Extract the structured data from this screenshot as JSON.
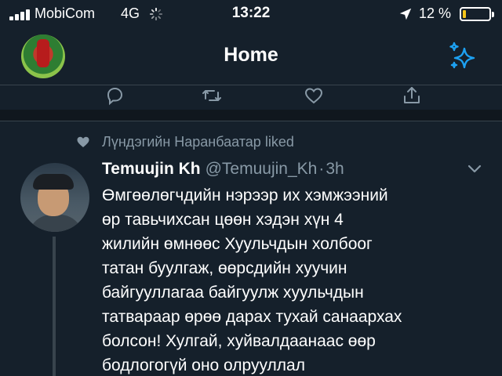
{
  "status_bar": {
    "carrier": "MobiCom",
    "network": "4G",
    "time": "13:22",
    "battery_text": "12 %",
    "battery_level": 0.12,
    "signal_bars": 4
  },
  "header": {
    "title": "Home",
    "accent_color": "#1da1f2"
  },
  "prev_tweet_actions": {
    "icons": [
      "reply-icon",
      "retweet-icon",
      "like-icon",
      "share-icon"
    ]
  },
  "tweet": {
    "social_context": "Лүндэгийн Наранбаатар liked",
    "author_name": "Temuujin Kh",
    "author_handle": "@Temuujin_Kh",
    "separator": "·",
    "time": "3h",
    "text_lines": [
      "Өмгөөлөгчдийн нэрээр их хэмжээний",
      "өр тавьчихсан цөөн хэдэн хүн 4",
      "жилийн өмнөөс Хуульчдын холбоог",
      "татан буулгаж, өөрсдийн хуучин",
      "байгууллагаа байгуулж хуульчдын",
      "татвараар өрөө дарах тухай санаархах",
      "болсон! Хулгай, хуйвалдаанаас өөр",
      "бодлогогүй оно олрууллал"
    ]
  },
  "colors": {
    "background": "#15202b",
    "secondary_text": "#8899a6",
    "divider": "#38444d",
    "battery_low": "#f5c518"
  }
}
